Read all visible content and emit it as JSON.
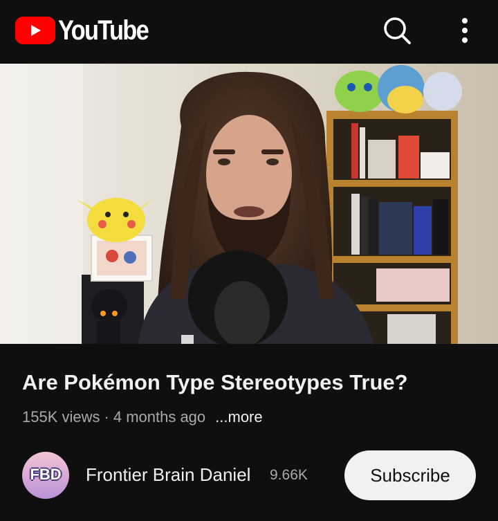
{
  "header": {
    "logo_text": "YouTube",
    "logo_icon": "youtube-play-icon",
    "search_icon": "search-icon",
    "more_icon": "more-vert-icon"
  },
  "video": {
    "title": "Are Pokémon Type Stereotypes True?",
    "views": "155K views",
    "separator": "·",
    "age": "4 months ago",
    "more_label": "...more"
  },
  "channel": {
    "avatar_text": "FBD",
    "name": "Frontier Brain Daniel",
    "subscribers": "9.66K",
    "subscribe_label": "Subscribe"
  },
  "colors": {
    "background": "#0f0f0f",
    "brand_red": "#ff0000",
    "text_primary": "#f1f1f1",
    "text_secondary": "#aaaaaa"
  }
}
